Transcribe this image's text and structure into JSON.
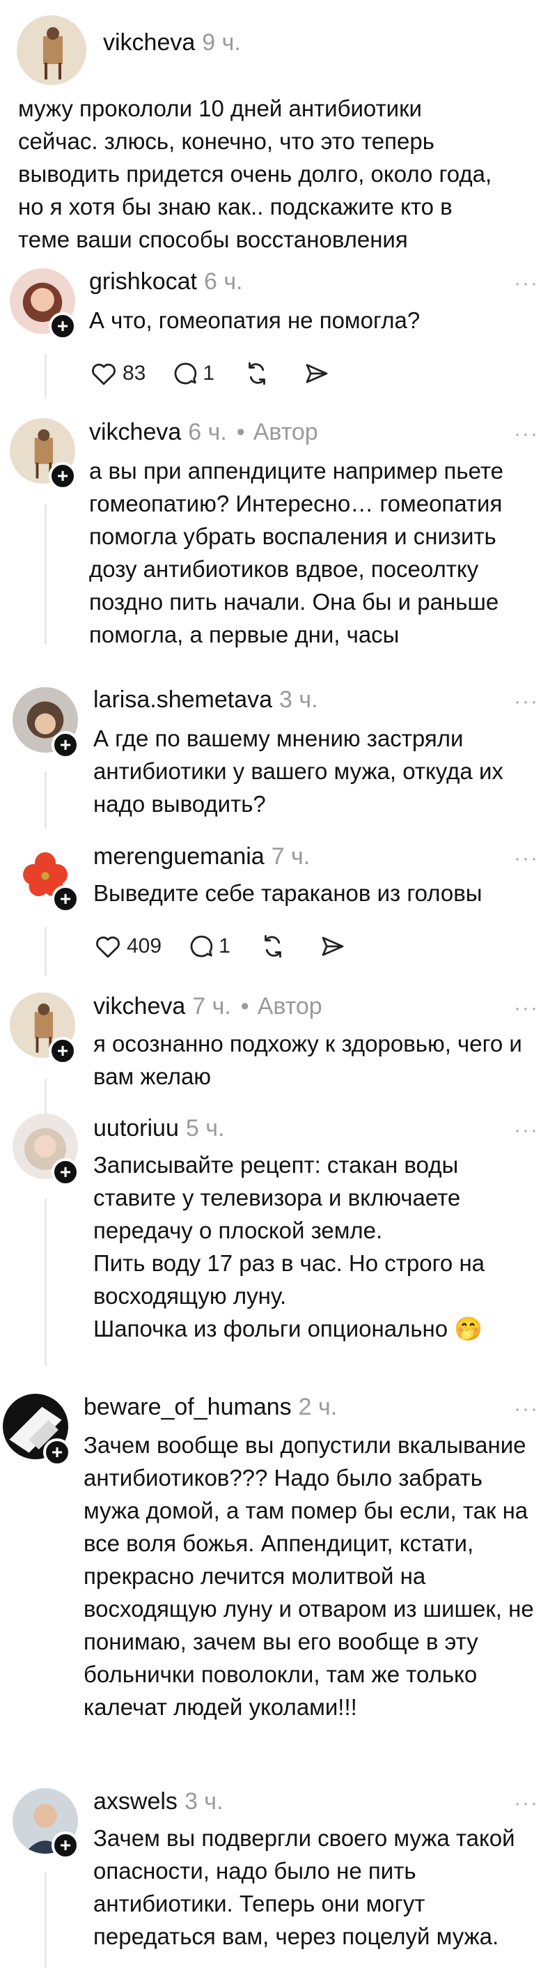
{
  "post": {
    "username": "vikcheva",
    "time": "9 ч.",
    "text": "мужу прокололи 10 дней антибиотики сейчас. злюсь, конечно, что это теперь выводить придется очень долго, около года, но я хотя бы знаю как.. подскажите кто в теме ваши способы восстановления"
  },
  "more_label": "···",
  "author_label": "Автор",
  "comments": [
    {
      "username": "grishkocat",
      "time": "6 ч.",
      "is_author": false,
      "text": "А что, гомеопатия не помогла?",
      "likes": "83",
      "replies": "1"
    },
    {
      "username": "vikcheva",
      "time": "6 ч.",
      "is_author": true,
      "text": "а вы при аппендиците например пьете гомеопатию? Интересно… гомеопатия помогла убрать воспаления и снизить дозу антибиотиков вдвое, посеолтку поздно пить начали. Она бы и раньше помогла, а первые дни, часы"
    },
    {
      "username": "larisa.shemetava",
      "time": "3 ч.",
      "is_author": false,
      "text": "А где по вашему мнению застряли антибиотики у вашего мужа, откуда их надо выводить?"
    },
    {
      "username": "merenguemania",
      "time": "7 ч.",
      "is_author": false,
      "text": "Выведите себе тараканов из головы",
      "likes": "409",
      "replies": "1"
    },
    {
      "username": "vikcheva",
      "time": "7 ч.",
      "is_author": true,
      "text": "я осознанно подхожу к здоровью, чего и вам желаю"
    },
    {
      "username": "uutoriuu",
      "time": "5 ч.",
      "is_author": false,
      "text_lines": [
        "Записывайте рецепт: стакан воды ставите у телевизора и включаете передачу о плоской земле.",
        "Пить воду 17 раз в час. Но строго на восходящую луну.",
        "Шапочка из фольги опционально 🤭"
      ]
    },
    {
      "username": "beware_of_humans",
      "time": "2 ч.",
      "is_author": false,
      "text": "Зачем вообще вы допустили вкалывание антибиотиков??? Надо было забрать мужа домой, а там помер бы если, так на все воля божья. Аппендицит, кстати, прекрасно лечится молитвой на восходящую луну и отваром из шишек, не понимаю, зачем вы его вообще в эту больнички поволокли, там же только калечат людей уколами!!!"
    },
    {
      "username": "axswels",
      "time": "3 ч.",
      "is_author": false,
      "text": "Зачем вы подвергли своего мужа такой опасности, надо было не пить антибиотики. Теперь они могут передаться вам, через поцелуй мужа."
    }
  ],
  "icons": [
    "heart-icon",
    "reply-icon",
    "repost-icon",
    "share-icon",
    "follow-plus-icon",
    "more-icon"
  ],
  "colors": {
    "text": "#111111",
    "meta": "#9a9a9a",
    "thread_line": "#e8e8e8"
  }
}
